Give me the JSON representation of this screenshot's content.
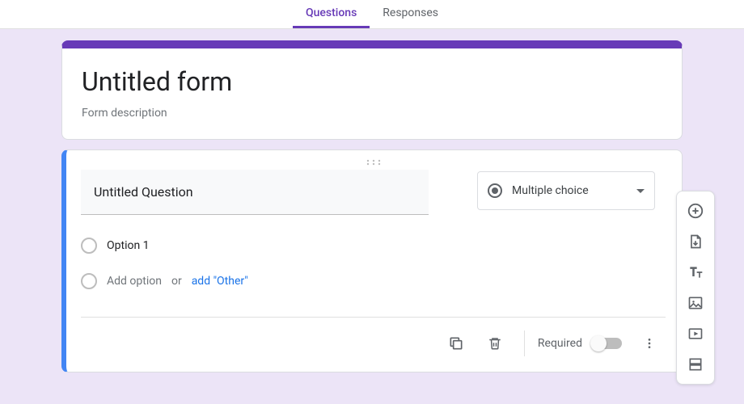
{
  "tabs": {
    "questions": "Questions",
    "responses": "Responses"
  },
  "header": {
    "title": "Untitled form",
    "description": "Form description"
  },
  "question": {
    "title": "Untitled Question",
    "type_label": "Multiple choice",
    "option1": "Option 1",
    "add_option": "Add option",
    "or": "or",
    "add_other": "add \"Other\"",
    "required_label": "Required"
  },
  "colors": {
    "primary": "#673ab7",
    "accent": "#4285f4"
  }
}
